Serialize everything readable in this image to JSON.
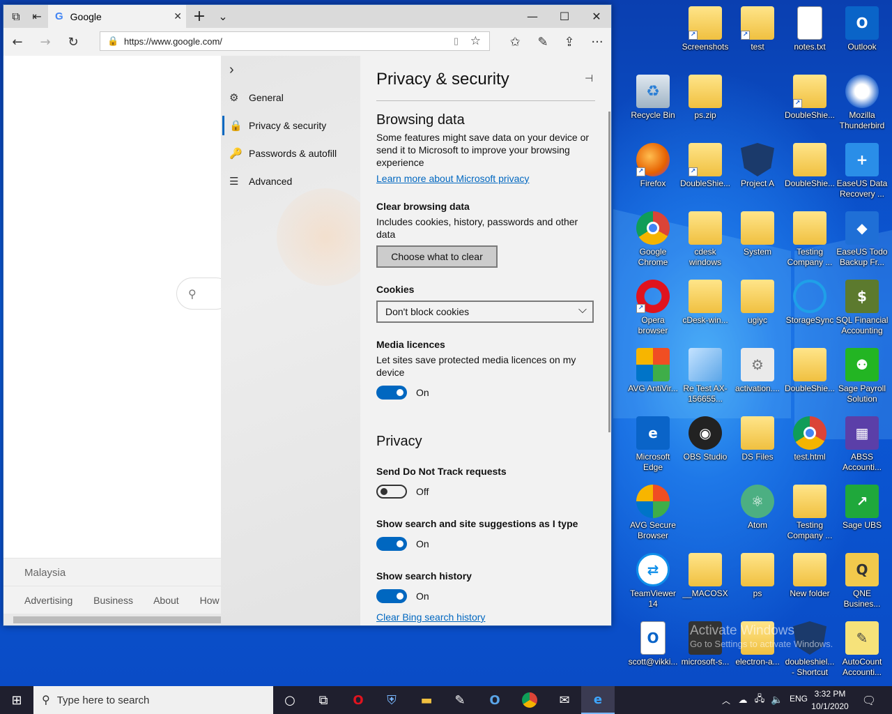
{
  "browser": {
    "tab_title": "Google",
    "tab_close": "✕",
    "new_tab": "+",
    "tab_menu": "⌄",
    "minimize": "—",
    "maximize": "☐",
    "close": "✕",
    "url": "https://www.google.com/",
    "back": "←",
    "forward": "→",
    "refresh": "↻",
    "more": "···"
  },
  "google_page": {
    "country": "Malaysia",
    "footer_links": [
      "Advertising",
      "Business",
      "About",
      "How Search works"
    ]
  },
  "settings_nav": {
    "collapse": "›",
    "items": [
      {
        "label": "General",
        "icon": "⚙"
      },
      {
        "label": "Privacy & security",
        "icon": "🔒"
      },
      {
        "label": "Passwords & autofill",
        "icon": "🔑"
      },
      {
        "label": "Advanced",
        "icon": "☰"
      }
    ]
  },
  "settings": {
    "title": "Privacy & security",
    "pin": "⊣",
    "browsing_data": {
      "heading": "Browsing data",
      "description": "Some features might save data on your device or send it to Microsoft to improve your browsing experience",
      "link": "Learn more about Microsoft privacy"
    },
    "clear": {
      "heading": "Clear browsing data",
      "description": "Includes cookies, history, passwords and other data",
      "button": "Choose what to clear"
    },
    "cookies": {
      "heading": "Cookies",
      "selected": "Don't block cookies"
    },
    "media": {
      "heading": "Media licences",
      "description": "Let sites save protected media licences on my device",
      "state": "On"
    },
    "privacy": {
      "heading": "Privacy",
      "dnt_heading": "Send Do Not Track requests",
      "dnt_state": "Off",
      "suggest_heading": "Show search and site suggestions as I type",
      "suggest_state": "On",
      "history_heading": "Show search history",
      "history_state": "On",
      "clear_history_link": "Clear Bing search history"
    }
  },
  "desktop_icons": [
    {
      "label": "Screenshots"
    },
    {
      "label": "test"
    },
    {
      "label": "notes.txt"
    },
    {
      "label": "Outlook"
    },
    {
      "label": "Recycle Bin"
    },
    {
      "label": "ps.zip"
    },
    {
      "label": "DoubleShie..."
    },
    {
      "label": "Mozilla Thunderbird"
    },
    {
      "label": "Firefox"
    },
    {
      "label": "DoubleShie..."
    },
    {
      "label": "Project A"
    },
    {
      "label": "DoubleShie..."
    },
    {
      "label": "EaseUS Data Recovery ..."
    },
    {
      "label": "Google Chrome"
    },
    {
      "label": "cdesk windows"
    },
    {
      "label": "System"
    },
    {
      "label": "Testing Company ..."
    },
    {
      "label": "EaseUS Todo Backup Fr..."
    },
    {
      "label": "Opera browser"
    },
    {
      "label": "cDesk-win..."
    },
    {
      "label": "ugiyc"
    },
    {
      "label": "StorageSync"
    },
    {
      "label": "SQL Financial Accounting"
    },
    {
      "label": "AVG AntiVir..."
    },
    {
      "label": "Re Test AX-156655..."
    },
    {
      "label": "activation...."
    },
    {
      "label": "DoubleShie..."
    },
    {
      "label": "Sage Payroll Solution"
    },
    {
      "label": "Microsoft Edge"
    },
    {
      "label": "OBS Studio"
    },
    {
      "label": "DS Files"
    },
    {
      "label": "test.html"
    },
    {
      "label": "ABSS Accounti..."
    },
    {
      "label": "AVG Secure Browser"
    },
    {
      "label": "Atom"
    },
    {
      "label": "Testing Company ..."
    },
    {
      "label": "Sage UBS"
    },
    {
      "label": "TeamViewer 14"
    },
    {
      "label": "__MACOSX"
    },
    {
      "label": "ps"
    },
    {
      "label": "New folder"
    },
    {
      "label": "QNE Busines..."
    },
    {
      "label": "scott@vikki..."
    },
    {
      "label": "microsoft-s..."
    },
    {
      "label": "electron-a..."
    },
    {
      "label": "doubleshiel... - Shortcut"
    },
    {
      "label": "AutoCount Accounti..."
    }
  ],
  "watermark": {
    "line1": "Activate Windows",
    "line2": "Go to Settings to activate Windows."
  },
  "taskbar": {
    "search_placeholder": "Type here to search",
    "lang": "ENG",
    "time": "3:32 PM",
    "date": "10/1/2020"
  }
}
